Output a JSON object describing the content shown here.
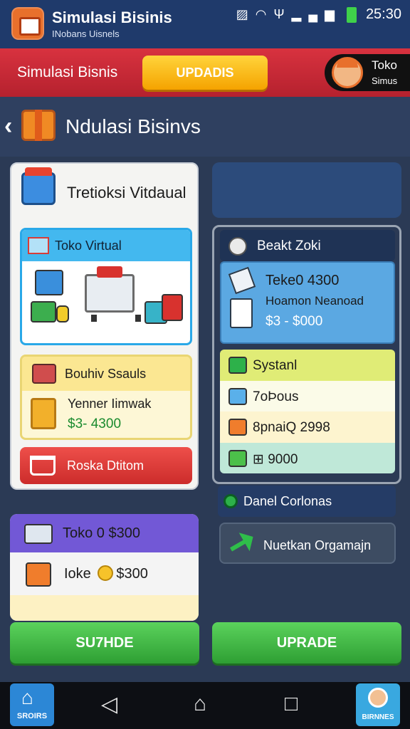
{
  "status_bar": {
    "app_title": "Simulasi Bisinis",
    "app_subtitle": "INobans Uisnels",
    "time": "25:30",
    "icons": [
      "sim-icon",
      "wifi-icon",
      "antenna-icon",
      "signal-icon",
      "battery-icon"
    ]
  },
  "header": {
    "title": "Simulasi Bisnis",
    "button_label": "UPDADIS",
    "shop_label_1": "Toko",
    "shop_label_2": "Simus"
  },
  "page": {
    "title": "Ndulasi Bisinvs"
  },
  "left_panel": {
    "title": "Tretioksi Vitdaual",
    "card_virtual": {
      "title": "Toko Virtual"
    },
    "card_bundle": {
      "title": "Bouhiv Ssauls",
      "line1": "Yenner Iimwak",
      "line2": "$3- 4300"
    },
    "card_red": {
      "label": "Roska Dtitom"
    }
  },
  "left_panel_2": {
    "row1": "Toko 0 $300",
    "row2_a": "Ioke",
    "row2_b": "$300"
  },
  "right_panel": {
    "head_title": "Beakt Zoki",
    "blue_card": {
      "line1": "Teke0 4300",
      "line2": "Hoamon Neanoad",
      "line3": "$3 - $000"
    },
    "list": [
      {
        "label": "Systanl",
        "bg": "#e0ec76",
        "icon_color": "#2db14a"
      },
      {
        "label": "7oÞous",
        "bg": "#fbfbe8",
        "icon_color": "#5ab0ea"
      },
      {
        "label": "8pnaiQ 2998",
        "bg": "#fdf4cf",
        "icon_color": "#f07d2c"
      },
      {
        "label": "⊞ 9000",
        "bg": "#bfe8d8",
        "icon_color": "#4cc04a"
      }
    ],
    "ribbon_label": "Danel Corlonas",
    "green_button_label": "Nuetkan Orgamajn"
  },
  "buttons": {
    "left": "SU7HDE",
    "right": "UPRADE"
  },
  "nav": {
    "home_label": "SROIRS",
    "profile_label": "BIRNNES"
  },
  "colors": {
    "status_bar": "#1f3a6b",
    "header": "#d8323f",
    "accent_yellow": "#f5a300",
    "green_button": "#2e9f33"
  }
}
